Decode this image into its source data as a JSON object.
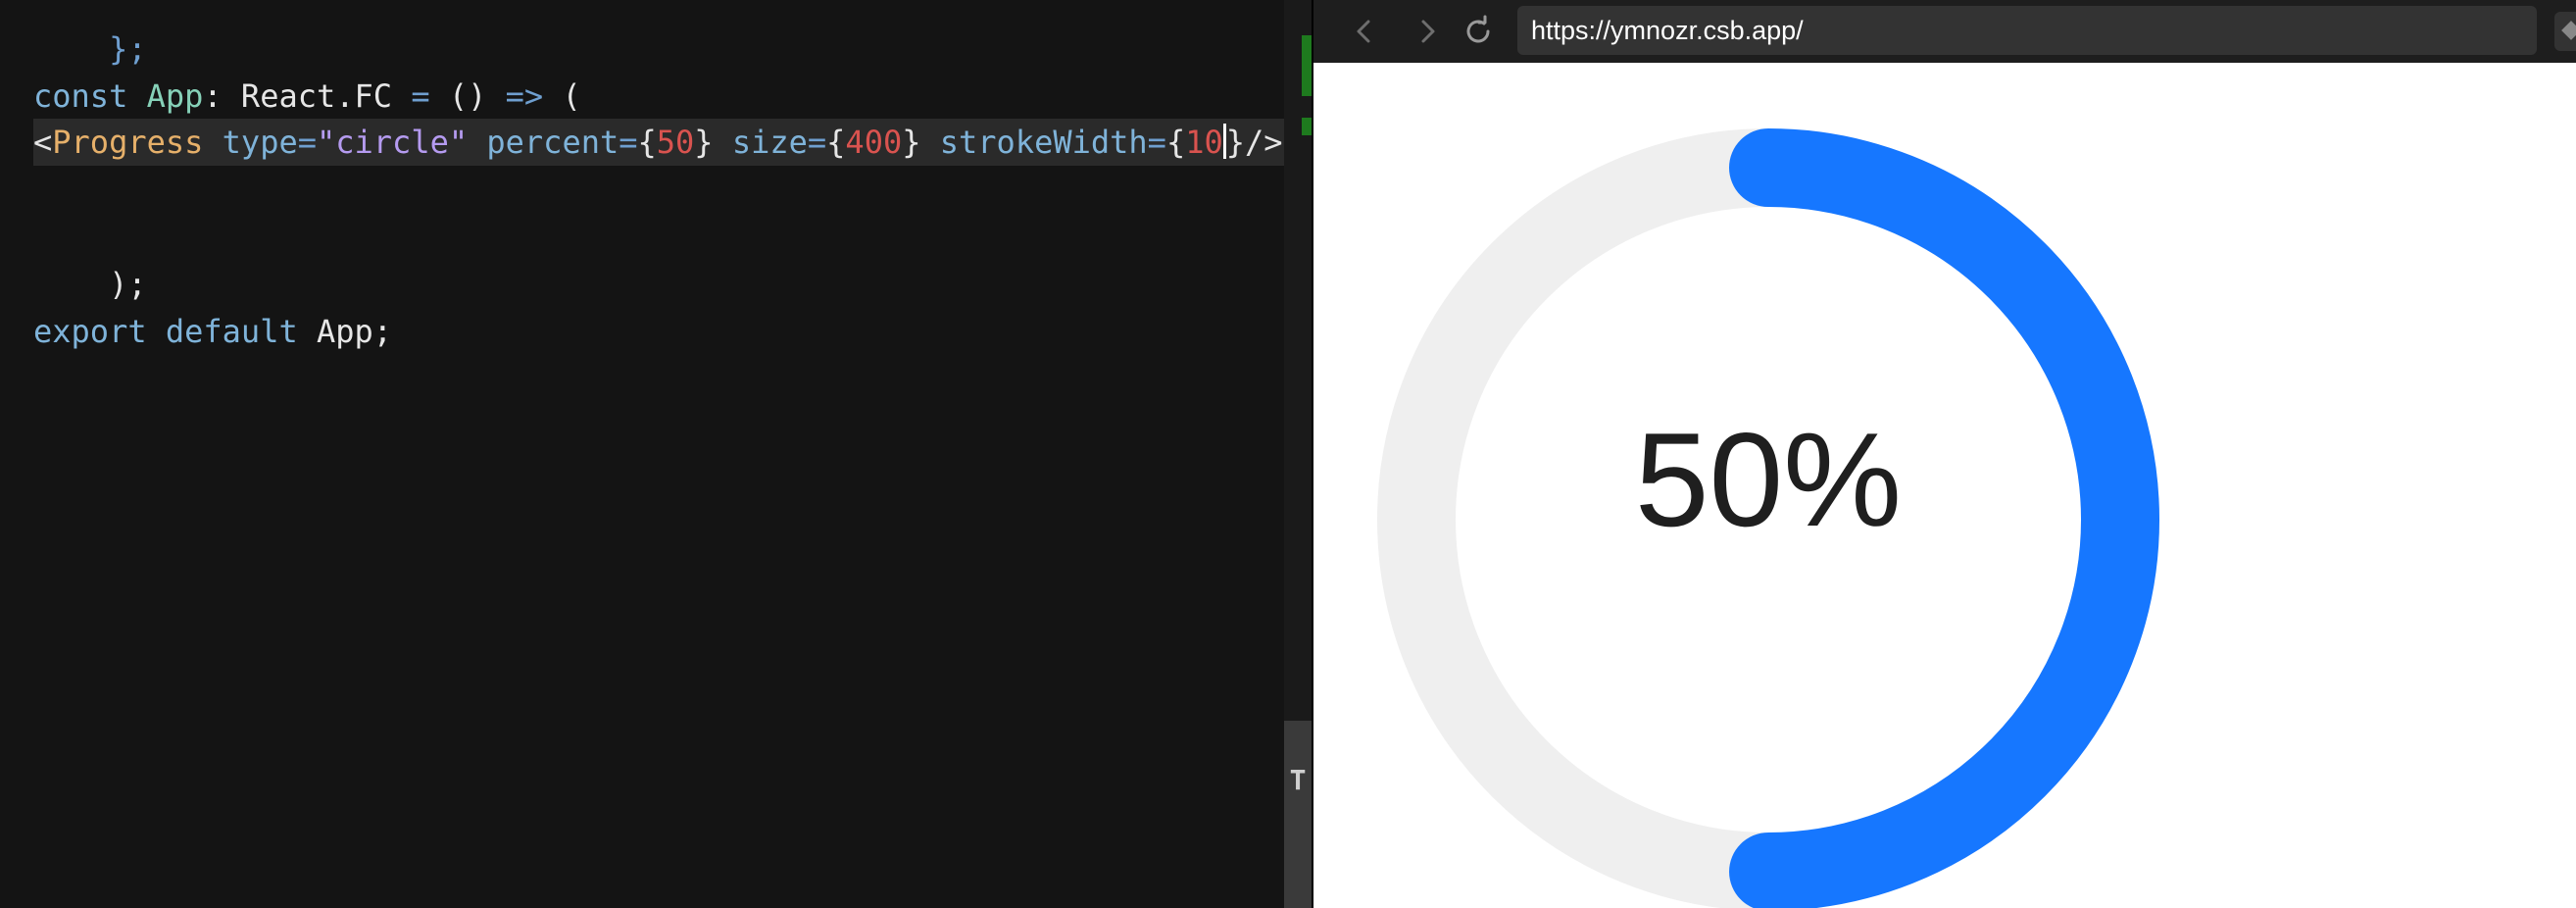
{
  "editor": {
    "lines": {
      "l0": "};",
      "l1": {
        "kw_const": "const",
        "id_app": "App",
        "colon": ":",
        "type": "React.FC",
        "eq": "=",
        "parens": "()",
        "arrow": "=>",
        "open": "("
      },
      "l2": {
        "lt": "<",
        "tag": "Progress",
        "attr_type": "type",
        "eq": "=",
        "type_value": "\"circle\"",
        "attr_percent": "percent",
        "percent_value": "50",
        "attr_size": "size",
        "size_value": "400",
        "attr_stroke": "strokeWidth",
        "stroke_value_a": "10",
        "close": "/>",
        "lbrace": "{",
        "rbrace": "}"
      },
      "l4": ");",
      "l6": {
        "kw_export": "export",
        "kw_default": "default",
        "id_app": "App",
        "semi": ";"
      }
    },
    "colors": {
      "background": "#141414",
      "keyword": "#7fb3d9",
      "identifier": "#86d1b8",
      "tag": "#e6b06a",
      "string": "#b59bf0",
      "number": "#d9534f"
    },
    "scroll_grip_icon": "T"
  },
  "browser": {
    "back_icon": "chevron-left-icon",
    "forward_icon": "chevron-right-icon",
    "reload_icon": "reload-icon",
    "url": "https://ymnozr.csb.app/",
    "progress": {
      "percent": 50,
      "label": "50%",
      "stroke_color": "#1677ff",
      "trail_color": "#efefef",
      "text_color": "#1f1f1f"
    }
  }
}
